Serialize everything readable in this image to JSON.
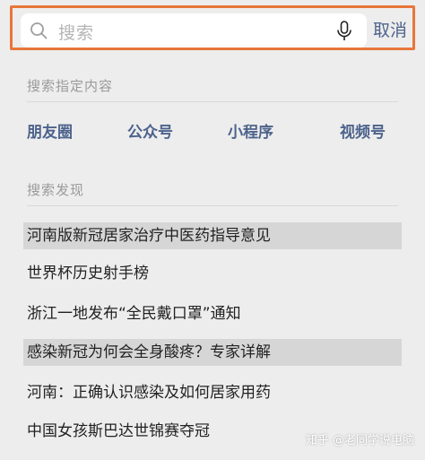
{
  "search": {
    "placeholder": "搜索",
    "cancel_label": "取消"
  },
  "specified": {
    "title": "搜索指定内容",
    "categories": [
      "朋友圈",
      "公众号",
      "小程序",
      "视频号"
    ]
  },
  "discover": {
    "title": "搜索发现",
    "items": [
      {
        "text": "河南版新冠居家治疗中医药指导意见",
        "highlighted": true
      },
      {
        "text": "世界杯历史射手榜",
        "highlighted": false
      },
      {
        "text": "浙江一地发布“全民戴口罩”通知",
        "highlighted": false
      },
      {
        "text": "感染新冠为何会全身酸疼？专家详解",
        "highlighted": true
      },
      {
        "text": "河南：正确认识感染及如何居家用药",
        "highlighted": false
      },
      {
        "text": "中国女孩斯巴达世锦赛夺冠",
        "highlighted": false
      }
    ]
  },
  "watermark": "知乎 @老同学说电脑",
  "colors": {
    "accent": "#4d638c",
    "frame": "#e8763a",
    "background": "#ededed"
  }
}
